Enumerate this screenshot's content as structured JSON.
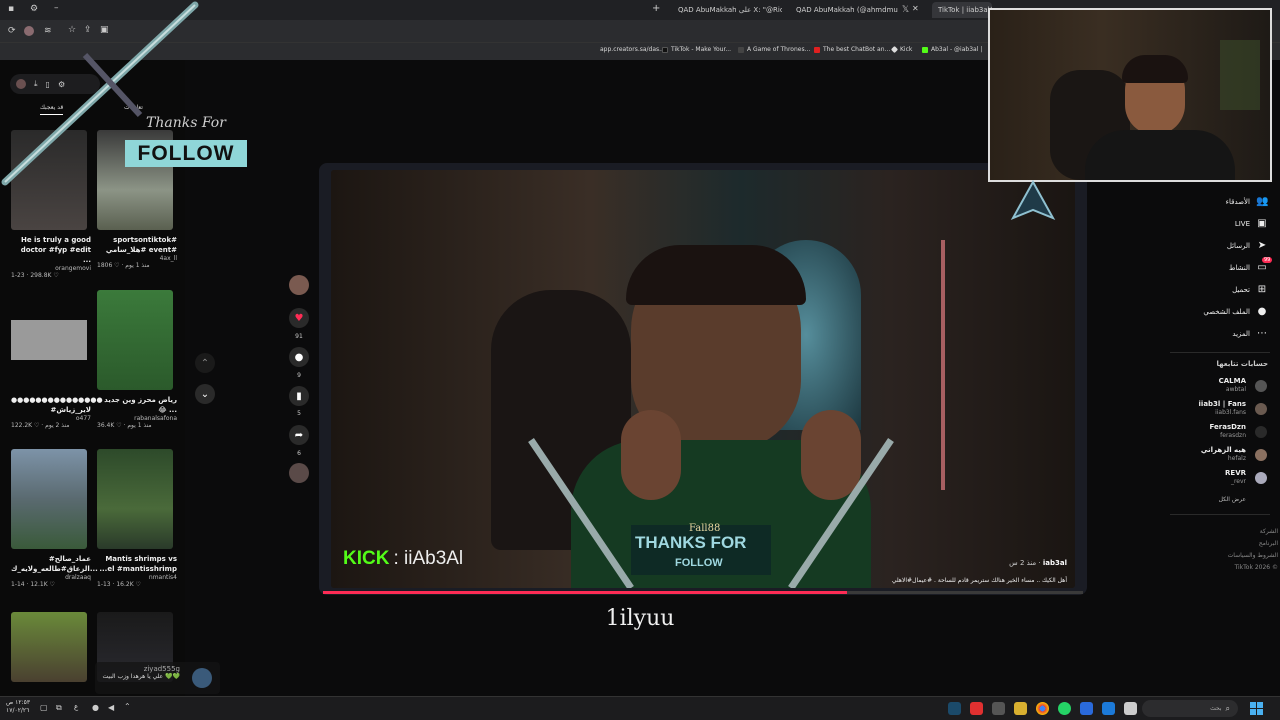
{
  "browser": {
    "tabs": [
      {
        "label": "QAD AbuMakkah على X: \"@Rio"
      },
      {
        "label": "QAD AbuMakkah (@ahmdmu"
      },
      {
        "label": "TikTok | iiab3al@"
      }
    ],
    "new_tab": "+",
    "bookmarks": [
      "app.creators.sa/das...",
      "TikTok - Make Your...",
      "A Game of Thrones...",
      "The best ChatBot an...",
      "Kick",
      "Ab3al - @iab3al |"
    ]
  },
  "feed": {
    "tabs": [
      "قد يعجبك",
      "تعليقات"
    ],
    "items": [
      {
        "caption": "He is truly a good doctor #fyp #edit ...",
        "author": "orangemovi",
        "stats": "1-23 · 298.8K ♡",
        "thumb": "#3d3a38"
      },
      {
        "caption": "sportsontiktok# هلا_سامي# event#",
        "author": "4ax_ll",
        "stats": "1806 ♡ · منذ 1 يوم",
        "thumb": "#6c7560"
      },
      {
        "caption": "●●●●●●●●●●●●●●● #لاير_زياش",
        "author": "o477",
        "stats": "122.2K ♡ · منذ 2 يوم",
        "thumb": "#8a8a8a"
      },
      {
        "caption": "رياض محرز وين جديد 😂 ...",
        "author": "rabanalsafona",
        "stats": "36.4K ♡ · منذ 1 يوم",
        "thumb": "#2e6a2e"
      },
      {
        "caption": "#عماد_صالح الزعاق#طالعه_ولايه_ك...",
        "author": "dralzaaq",
        "stats": "1-14 · 12.1K ♡",
        "thumb": "#6a7888"
      },
      {
        "caption": "Mantis shrimps vs ...el #mantisshrimp",
        "author": "nmantis4",
        "stats": "1-13 · 16.2K ♡",
        "thumb": "#335a30"
      }
    ],
    "chat_user": "ziyad555g",
    "chat_text": "علي يا هرهدا وزب البيت 💚💚"
  },
  "overlay": {
    "thanks_script": "Thanks For",
    "follow": "FOLLOW",
    "kick_brand": "KICK",
    "kick_handle": ": iiAb3Al",
    "follower_name": "Fall88",
    "thanks_for": "THANKS FOR",
    "follow_small": "FOLLOW",
    "subtitle": "1ilyuu"
  },
  "video": {
    "author": "iab3al",
    "time": "منذ 2 س",
    "description": "أهل الكيك .. مساء الخير هنالك ستريمر قادم للساحة . #عيمال#الاهلي",
    "progress": 0.69,
    "colors": {
      "accent": "#fe2c55",
      "kick": "#53fc18",
      "teal": "#7fd6d8"
    }
  },
  "rail": {
    "likes": "91",
    "comments": "9",
    "saves": "5",
    "shares": "6"
  },
  "sidebar": {
    "nav": [
      {
        "label": "الأصدقاء",
        "icon": "users-icon"
      },
      {
        "label": "LIVE",
        "icon": "live-icon"
      },
      {
        "label": "الرسائل",
        "icon": "send-icon"
      },
      {
        "label": "النشاط",
        "icon": "inbox-icon",
        "badge": "99"
      },
      {
        "label": "تحميل",
        "icon": "upload-icon"
      },
      {
        "label": "الملف الشخصي",
        "icon": "profile-icon"
      },
      {
        "label": "المزيد",
        "icon": "more-icon"
      }
    ],
    "following_title": "حسابات تتابعها",
    "following": [
      {
        "name": "CALMA",
        "handle": "awbtal"
      },
      {
        "name": "iiab3l | Fans",
        "handle": "iiab3l.fans"
      },
      {
        "name": "FerasDzn",
        "handle": "ferasdzn"
      },
      {
        "name": "هيه الزهراني",
        "handle": "hefalz"
      },
      {
        "name": "REVR",
        "handle": "_revr"
      }
    ],
    "see_all": "عرض الكل",
    "footer": [
      "الشركة",
      "البرنامج",
      "الشروط والسياسات",
      "TikTok 2026 ©"
    ]
  },
  "taskbar": {
    "time": "١٢:٥٣ ص",
    "date": "١٧/٠٢/٢٦",
    "search_placeholder": "بحث",
    "lang": "ع"
  }
}
